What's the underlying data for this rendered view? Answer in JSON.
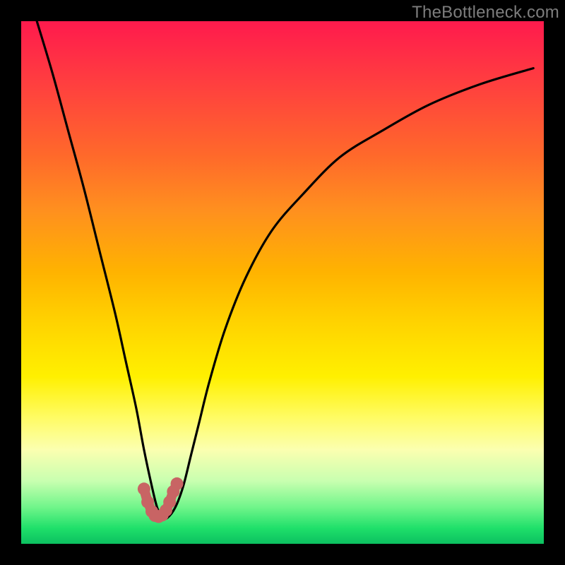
{
  "watermark": "TheBottleneck.com",
  "chart_data": {
    "type": "line",
    "title": "",
    "xlabel": "",
    "ylabel": "",
    "xlim": [
      0,
      100
    ],
    "ylim": [
      0,
      100
    ],
    "series": [
      {
        "name": "bottleneck-curve",
        "x": [
          3,
          6,
          9,
          12,
          15,
          18,
          20,
          22,
          23.5,
          25,
          26,
          27,
          28,
          29.5,
          31,
          32.5,
          34,
          36,
          39,
          43,
          48,
          54,
          61,
          69,
          78,
          88,
          98
        ],
        "values": [
          100,
          90,
          79,
          68,
          56,
          44,
          35,
          26,
          18,
          11,
          7,
          5,
          5,
          7,
          11,
          17,
          23,
          31,
          41,
          51,
          60,
          67,
          74,
          79,
          84,
          88,
          91
        ]
      },
      {
        "name": "optimal-marker",
        "x": [
          23.5,
          24.2,
          25.0,
          25.6,
          26.3,
          27.0,
          27.7,
          28.4,
          29.1,
          29.8
        ],
        "values": [
          10.5,
          8.0,
          6.2,
          5.4,
          5.2,
          5.5,
          6.4,
          8.0,
          10.0,
          11.5
        ]
      }
    ],
    "colors": {
      "curve": "#000000",
      "marker": "#c86464",
      "gradient_top": "#ff1a4d",
      "gradient_bottom": "#0cc060"
    }
  }
}
